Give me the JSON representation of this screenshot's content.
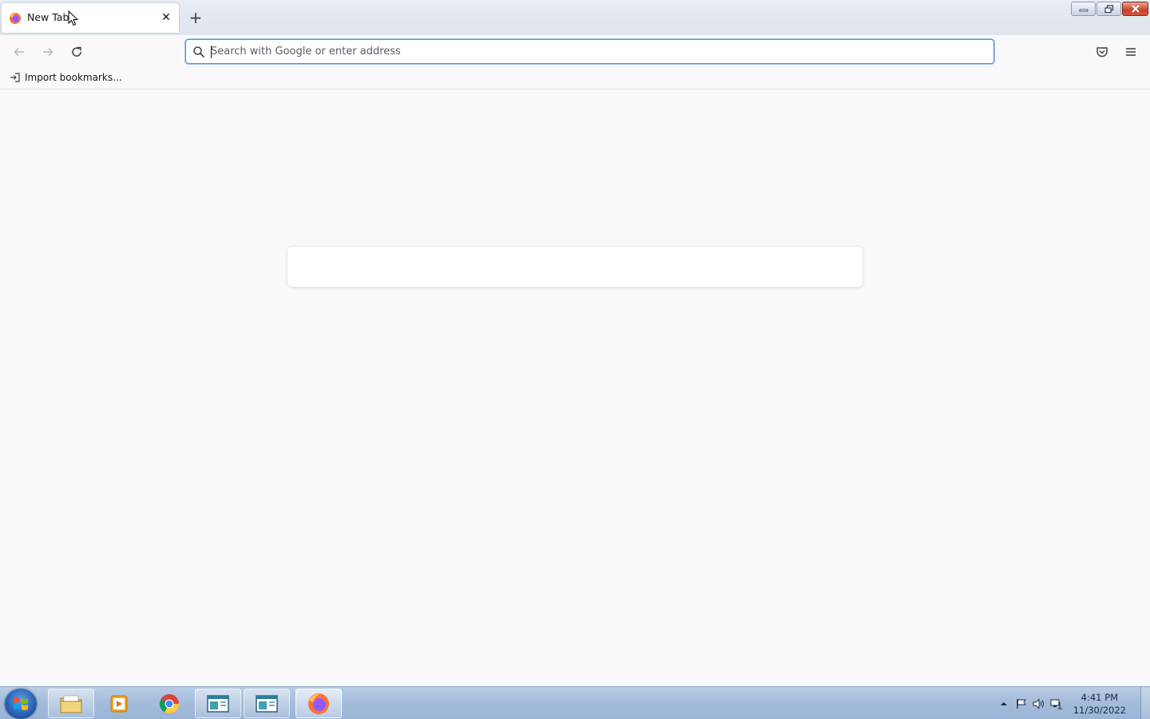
{
  "tabs": [
    {
      "title": "New Tab",
      "active": true
    }
  ],
  "tab_close_glyph": "✕",
  "new_tab_glyph": "+",
  "urlbar": {
    "placeholder": "Search with Google or enter address",
    "value": ""
  },
  "bookmarks_bar": {
    "items": [
      {
        "label": "Import bookmarks...",
        "icon": "import-icon"
      }
    ]
  },
  "taskbar": {
    "pinned": [
      {
        "name": "file-explorer"
      },
      {
        "name": "media-player"
      },
      {
        "name": "chrome"
      },
      {
        "name": "app-window-1"
      },
      {
        "name": "app-window-2"
      },
      {
        "name": "firefox",
        "active": true
      }
    ],
    "clock": {
      "time": "4:41 PM",
      "date": "11/30/2022"
    }
  },
  "colors": {
    "accent": "#5a8fd8",
    "background": "#f9f9fb",
    "taskbar": "#a5bddb"
  }
}
